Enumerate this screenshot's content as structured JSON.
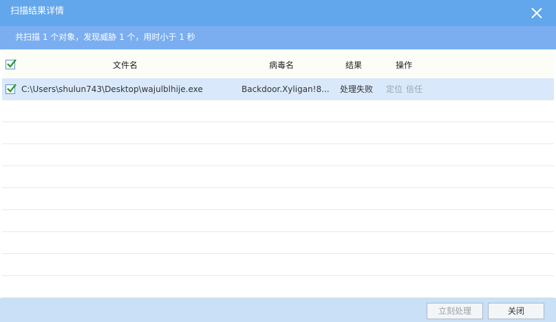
{
  "dialog": {
    "title": "扫描结果详情",
    "summary": "共扫描 1 个对象，发现威胁 1 个，用时小于 1 秒"
  },
  "table": {
    "headers": {
      "file": "文件名",
      "virus": "病毒名",
      "result": "结果",
      "action": "操作"
    },
    "rows": [
      {
        "checked": true,
        "file": "C:\\Users\\shulun743\\Desktop\\wajulblhije.exe",
        "virus": "Backdoor.Xyligan!8...",
        "result": "处理失败",
        "action_locate": "定位",
        "action_trust": "信任"
      }
    ]
  },
  "footer": {
    "process_now": "立刻处理",
    "close": "关闭"
  },
  "colors": {
    "titlebar": "#62a6ec",
    "summary_bar": "#7aaef1",
    "selected_row": "#d9e9fb",
    "footer": "#c9e0f7",
    "check": "#2e9a2e"
  },
  "icons": [
    "close-icon",
    "checkmark-icon"
  ]
}
